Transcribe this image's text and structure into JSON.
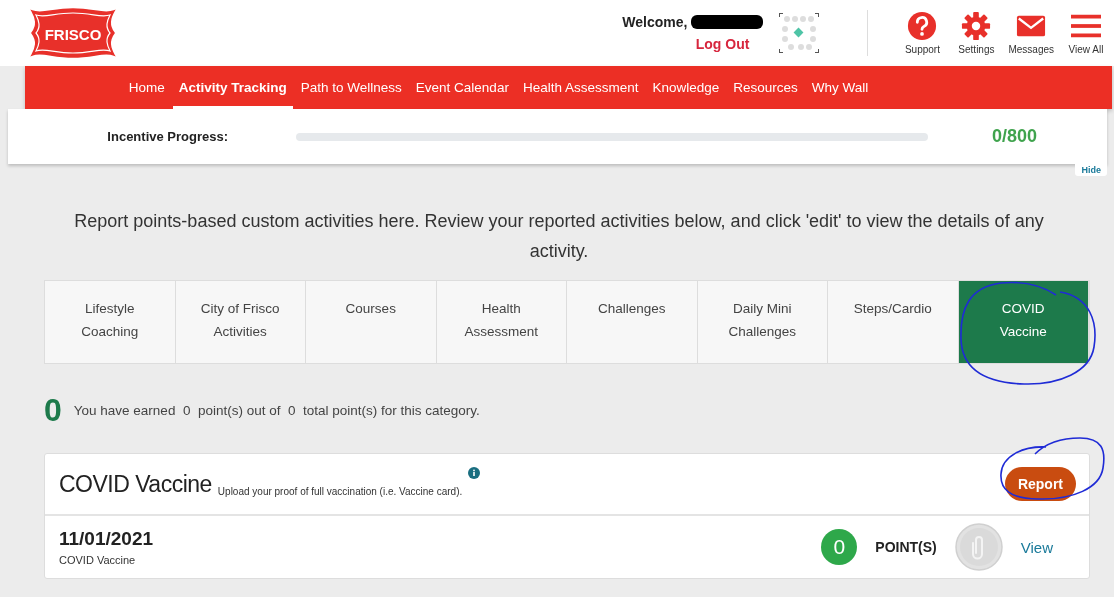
{
  "header": {
    "logo": "FRISCO",
    "welcome": "Welcome,",
    "logout": "Log Out",
    "icons": [
      {
        "label": "Support",
        "kind": "support"
      },
      {
        "label": "Settings",
        "kind": "settings"
      },
      {
        "label": "Messages",
        "kind": "messages"
      },
      {
        "label": "View All",
        "kind": "menu"
      }
    ]
  },
  "nav": [
    {
      "label": "Home",
      "selected": false
    },
    {
      "label": "Activity Tracking",
      "selected": true
    },
    {
      "label": "Path to Wellness",
      "selected": false
    },
    {
      "label": "Event Calendar",
      "selected": false
    },
    {
      "label": "Health Assessment",
      "selected": false
    },
    {
      "label": "Knowledge",
      "selected": false
    },
    {
      "label": "Resources",
      "selected": false
    },
    {
      "label": "Why Wall",
      "selected": false
    }
  ],
  "incentive": {
    "label": "Incentive Progress:",
    "level": 0,
    "reading": "0/800",
    "hide": "Hide"
  },
  "intro": "Report points-based custom activities here. Review your reported activities below, and click 'edit' to view the details of any activity.",
  "tabs": [
    {
      "label": "Lifestyle Coaching",
      "selected": false
    },
    {
      "label": "City of Frisco Activities",
      "selected": false
    },
    {
      "label": "Courses",
      "selected": false
    },
    {
      "label": "Health Assessment",
      "selected": false
    },
    {
      "label": "Challenges",
      "selected": false
    },
    {
      "label": "Daily Mini Challenges",
      "selected": false
    },
    {
      "label": "Steps/Cardio",
      "selected": false
    },
    {
      "label": "COVID Vaccine",
      "selected": true
    }
  ],
  "earned": {
    "big": "0",
    "text": "You have earned  0  point(s) out of  0  total point(s) for this category."
  },
  "card": {
    "title": "COVID Vaccine",
    "subtitle": "Upload your proof of full vaccination (i.e. Vaccine card).",
    "button": "Report",
    "entries": [
      {
        "date": "11/01/2021",
        "name": "COVID Vaccine",
        "points": "0",
        "points_label": "POINT(S)",
        "link": "View"
      }
    ]
  }
}
